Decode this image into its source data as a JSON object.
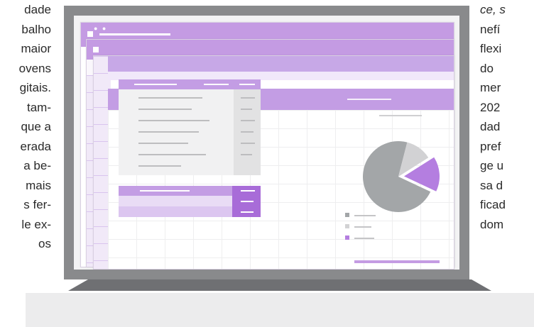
{
  "left_text": [
    "dade",
    "balho",
    "maior",
    "ovens",
    "gitais.",
    "tam-",
    "que a",
    "erada",
    "a be-",
    "mais",
    "s fer-",
    "le ex-",
    "os"
  ],
  "right_text": [
    "ce, s",
    "nefí",
    "flexi",
    "do",
    "mer",
    "202",
    "dad",
    "pref",
    "ge u",
    "sa d",
    "ficad",
    "dom"
  ],
  "colors": {
    "accent": "#c39de4",
    "accent_dark": "#a86cd8",
    "bezel": "#898a8c",
    "pie_gray": "#a3a6a8",
    "pie_light": "#d2d2d4"
  },
  "chart_data": {
    "type": "pie",
    "title": "",
    "slices": [
      {
        "value": 72,
        "color": "#a3a6a8"
      },
      {
        "value": 12,
        "color": "#d2d2d4"
      },
      {
        "value": 16,
        "color": "#b47ee0"
      }
    ]
  }
}
